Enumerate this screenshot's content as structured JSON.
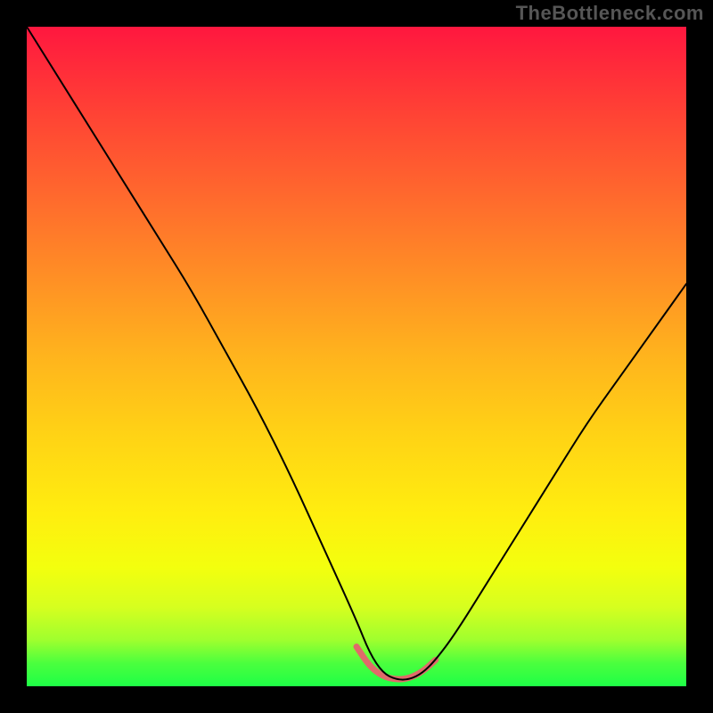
{
  "watermark": "TheBottleneck.com",
  "chart_data": {
    "type": "line",
    "title": "",
    "xlabel": "",
    "ylabel": "",
    "xlim": [
      0,
      100
    ],
    "ylim": [
      0,
      100
    ],
    "grid": false,
    "legend": false,
    "background_gradient": {
      "direction": "vertical",
      "stops": [
        {
          "pos": 0.0,
          "color": "#ff173f"
        },
        {
          "pos": 0.5,
          "color": "#ffb41d"
        },
        {
          "pos": 0.82,
          "color": "#f3ff0e"
        },
        {
          "pos": 0.96,
          "color": "#4bff3e"
        },
        {
          "pos": 1.0,
          "color": "#1eff46"
        }
      ]
    },
    "series": [
      {
        "name": "bottleneck-curve",
        "color": "#000000",
        "stroke_width": 2,
        "x": [
          0,
          5,
          10,
          15,
          20,
          25,
          30,
          35,
          40,
          45,
          50,
          52,
          54,
          56,
          58,
          60,
          62,
          65,
          70,
          75,
          80,
          85,
          90,
          95,
          100
        ],
        "y": [
          100,
          92,
          84,
          76,
          68,
          60,
          51,
          42,
          32,
          21,
          10,
          5,
          2,
          1,
          1,
          2,
          4,
          8,
          16,
          24,
          32,
          40,
          47,
          54,
          61
        ]
      },
      {
        "name": "trough-highlight",
        "color": "#e06a6a",
        "stroke_width": 7,
        "x": [
          50,
          52,
          54,
          56,
          58,
          60,
          62
        ],
        "y": [
          6,
          3,
          1.5,
          1,
          1.2,
          2.2,
          4
        ]
      }
    ],
    "annotations": []
  }
}
